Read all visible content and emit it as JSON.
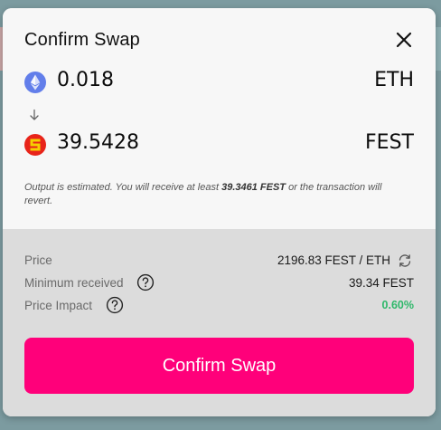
{
  "modal": {
    "title": "Confirm Swap"
  },
  "input_token": {
    "amount": "0.018",
    "symbol": "ETH",
    "icon": "eth-icon"
  },
  "output_token": {
    "amount": "39.5428",
    "symbol": "FEST",
    "icon": "fest-token-icon"
  },
  "estimate": {
    "prefix": "Output is estimated. You will receive at least ",
    "min_amount": "39.3461 FEST",
    "suffix": " or the transaction will revert."
  },
  "details": {
    "price_label": "Price",
    "price_value": "2196.83 FEST / ETH",
    "minimum_label": "Minimum received",
    "minimum_value": "39.34 FEST",
    "impact_label": "Price Impact",
    "impact_value": "0.60%"
  },
  "confirm_button": {
    "label": "Confirm Swap"
  },
  "colors": {
    "accent": "#ff007a",
    "impact_good": "#2eb86a",
    "eth_icon": "#627eea",
    "fest_icon_bg": "#e8241a",
    "fest_icon_fg": "#f5d000"
  }
}
